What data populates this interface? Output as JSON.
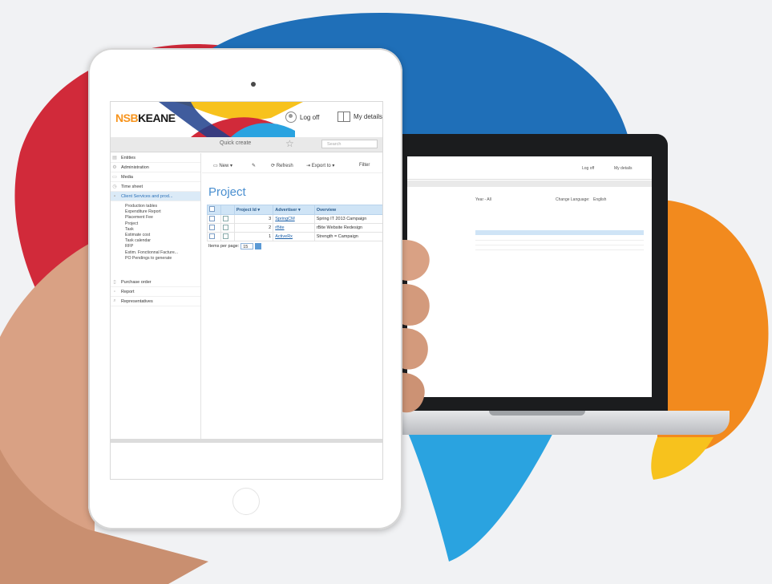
{
  "colors": {
    "red": "#d12a3a",
    "blue": "#1f6fb8",
    "lightblue": "#2aa3e0",
    "orange": "#f28a1e",
    "yellow": "#f7c21d"
  },
  "tablet": {
    "header": {
      "logo_prefix": "NSB",
      "logo_suffix": "KEANE",
      "logoff": "Log off",
      "details": "My details"
    },
    "quickbar": {
      "quick_create": "Quick create",
      "search_placeholder": "Search"
    },
    "sidebar": {
      "items": [
        {
          "label": "Entities",
          "icon": "entities-icon"
        },
        {
          "label": "Administration",
          "icon": "gear-icon"
        },
        {
          "label": "Media",
          "icon": "media-icon"
        },
        {
          "label": "Time sheet",
          "icon": "clock-icon"
        },
        {
          "label": "Client Services and prod...",
          "icon": "client-icon"
        }
      ],
      "subitems": [
        "Production tables",
        "Expenditure Report",
        "Placement Fee",
        "Project",
        "Task",
        "Estimate cost",
        "Task calendar",
        "RFP",
        "Estim. Fonctionnal Facture...",
        "PO Pendings to generate"
      ],
      "bottom_items": [
        {
          "label": "Purchase order",
          "icon": "purchase-icon"
        },
        {
          "label": "Report",
          "icon": "report-icon"
        },
        {
          "label": "Representatives",
          "icon": "search-icon"
        }
      ]
    },
    "toolbar": {
      "new": "New",
      "refresh": "Refresh",
      "export": "Export to",
      "filter": "Filter"
    },
    "page_title": "Project",
    "grid": {
      "columns": [
        "",
        "",
        "Project Id",
        "Advertiser",
        "Overview"
      ],
      "rows": [
        {
          "id": "3",
          "advertiser": "SpringCM",
          "overview": "Spring IT 2013 Campaign"
        },
        {
          "id": "2",
          "advertiser": "rBite",
          "overview": "rBite Website Redesign"
        },
        {
          "id": "1",
          "advertiser": "ActiveRx",
          "overview": "Strength = Campaign"
        }
      ]
    },
    "pager": {
      "label": "Items per page:",
      "value": "15"
    }
  },
  "laptop": {
    "header": {
      "logoff": "Log off",
      "details": "My details"
    },
    "filters": {
      "year": "Year - All",
      "language_label": "Change Language:",
      "language": "English"
    }
  }
}
